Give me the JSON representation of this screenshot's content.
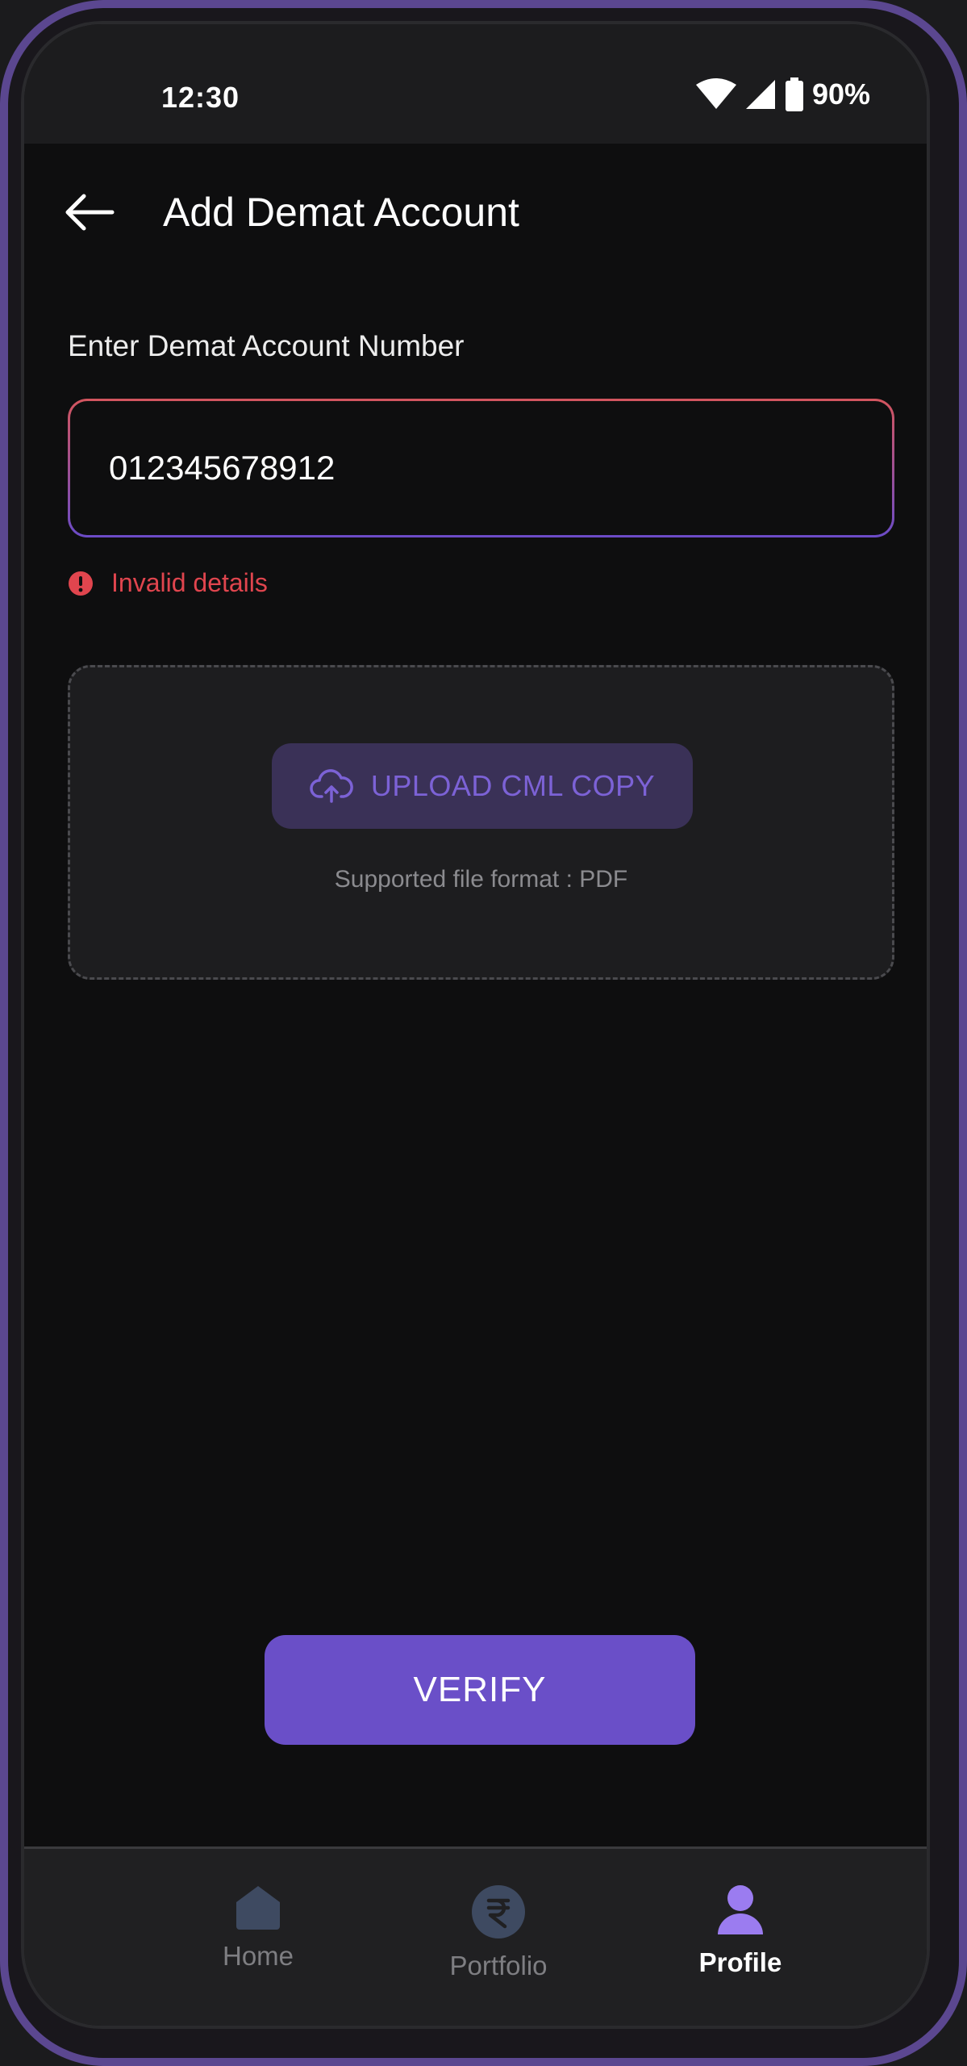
{
  "status_bar": {
    "time": "12:30",
    "battery": "90%"
  },
  "header": {
    "title": "Add Demat Account",
    "back_icon": "arrow-left-icon"
  },
  "form": {
    "account_label": "Enter Demat Account Number",
    "account_value": "012345678912",
    "error_text": "Invalid details",
    "upload_label": "UPLOAD CML COPY",
    "upload_hint": "Supported file format :  PDF",
    "verify_label": "VERIFY"
  },
  "nav": {
    "items": [
      {
        "label": "Home",
        "icon": "home-icon",
        "active": false
      },
      {
        "label": "Portfolio",
        "icon": "rupee-icon",
        "active": false
      },
      {
        "label": "Profile",
        "icon": "user-icon",
        "active": true
      }
    ]
  },
  "colors": {
    "accent": "#6a4fc8",
    "error": "#e0454e",
    "background": "#0e0e0f",
    "upload_button_bg": "#3a3157"
  }
}
